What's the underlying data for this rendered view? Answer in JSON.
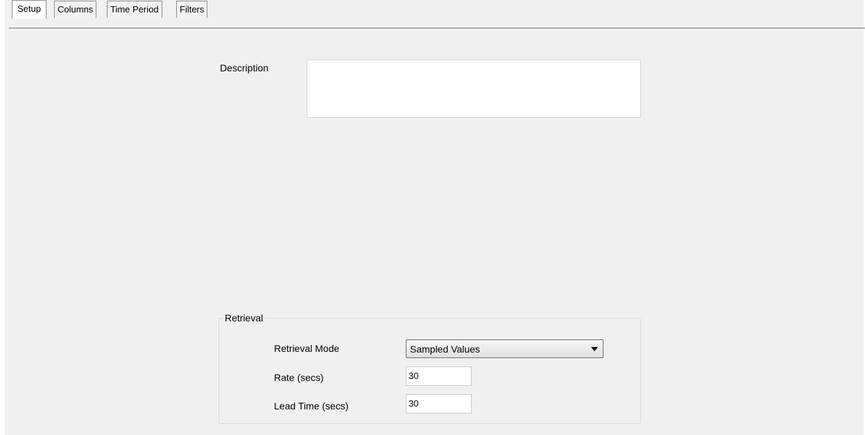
{
  "tabs": [
    "Setup",
    "Columns",
    "Time Period",
    "Filters"
  ],
  "description": {
    "label": "Description",
    "value": ""
  },
  "retrieval": {
    "group_title": "Retrieval",
    "mode_label": "Retrieval Mode",
    "mode_value": "Sampled Values",
    "rate_label": "Rate (secs)",
    "rate_value": "30",
    "lead_label": "Lead Time (secs)",
    "lead_value": "30"
  },
  "icons": {
    "dropdown": "chevron-down-icon"
  }
}
